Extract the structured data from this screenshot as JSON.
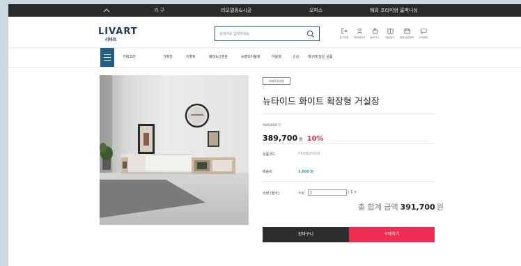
{
  "topbar": {
    "items": [
      "가 구",
      "리모델링&시공",
      "오피스",
      "해외 프리미엄 홈퍼니싱"
    ]
  },
  "header": {
    "logo": "LIVART",
    "logo_sub": "리바트",
    "search_placeholder": "검색어를 입력하세요",
    "icons": [
      {
        "icon": "logout-icon",
        "label": "로그아웃"
      },
      {
        "icon": "user-icon",
        "label": "마이페이지"
      },
      {
        "icon": "cart-icon",
        "label": "장바구니"
      },
      {
        "icon": "catalog-icon",
        "label": "매장찾기"
      },
      {
        "icon": "calendar-icon",
        "label": "방문상담예약"
      },
      {
        "icon": "chat-icon",
        "label": "고객센터"
      }
    ]
  },
  "nav": {
    "category": "카테고리",
    "items": [
      "기획전",
      "이벤트",
      "웨딩&신혼관",
      "브랜드아울렛",
      "아울렛",
      "신상",
      "재구매 높은 상품"
    ]
  },
  "product": {
    "badge": "리바트온라인",
    "title": "뉴타이드 화이트 확장형 거실장",
    "original_price": "433,000",
    "original_unit": "원",
    "price": "389,700",
    "price_unit": "원",
    "discount": "10%",
    "code_label": "상품코드",
    "code": "P100025025",
    "shipping_label": "배송비",
    "shipping": "3,000 원",
    "qty_row_label": "수량 (필수)",
    "qty_label": "수량",
    "qty_value": "1",
    "qty_stepper": "| 1 +",
    "total_label": "총 합계 금액",
    "total_amount": "391,700",
    "total_unit": "원"
  },
  "buttons": {
    "cart": "장바구니",
    "buy": "구매하기"
  },
  "colors": {
    "brand": "#1f5f86",
    "accent": "#ee2d50",
    "dark": "#2d2d2d",
    "shipping": "#2a9f96"
  }
}
